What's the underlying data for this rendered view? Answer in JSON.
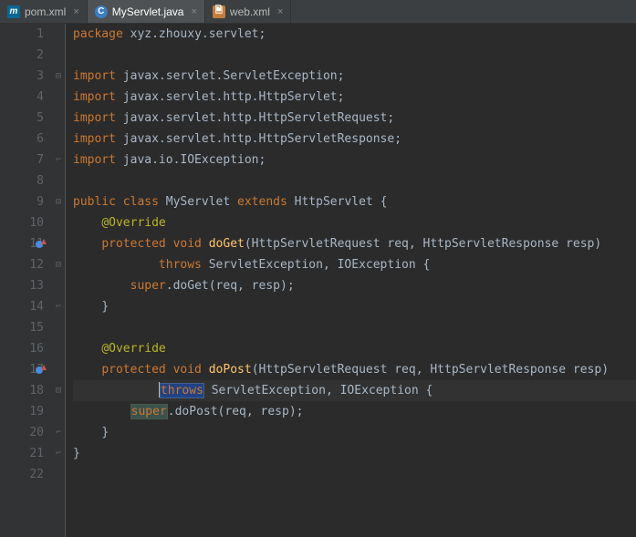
{
  "tabs": [
    {
      "icon": "m",
      "label": "pom.xml",
      "active": false
    },
    {
      "icon": "c",
      "label": "MyServlet.java",
      "active": true
    },
    {
      "icon": "x",
      "label": "web.xml",
      "active": false
    }
  ],
  "lines": {
    "l1_package": "package",
    "l1_pkg": " xyz.zhouxy.servlet",
    "l3_import": "import",
    "l3_val": " javax.servlet.ServletException",
    "l4_import": "import",
    "l4_val": " javax.servlet.http.HttpServlet",
    "l5_import": "import",
    "l5_val": " javax.servlet.http.HttpServletRequest",
    "l6_import": "import",
    "l6_val": " javax.servlet.http.HttpServletResponse",
    "l7_import": "import",
    "l7_val": " java.io.IOException",
    "l9_public": "public class ",
    "l9_name": "MyServlet",
    "l9_extends": " extends ",
    "l9_parent": "HttpServlet",
    "l9_brace": " {",
    "l10_ann": "@Override",
    "l11_mod": "protected void ",
    "l11_method": "doGet",
    "l11_params": "(HttpServletRequest req, HttpServletResponse resp)",
    "l12_throws": "throws",
    "l12_ex": " ServletException, IOException {",
    "l13_super": "super",
    "l13_call": ".doGet(req, resp)",
    "l14_brace": "}",
    "l16_ann": "@Override",
    "l17_mod": "protected void ",
    "l17_method": "doPost",
    "l17_params": "(HttpServletRequest req, HttpServletResponse resp)",
    "l18_throws": "throws",
    "l18_ex": " ServletException, IOException {",
    "l19_super": "super",
    "l19_call": ".doPost(req, resp)",
    "l20_brace": "}",
    "l21_brace": "}",
    "semicolon": ";"
  },
  "lineNumbers": [
    "1",
    "2",
    "3",
    "4",
    "5",
    "6",
    "7",
    "8",
    "9",
    "10",
    "11",
    "12",
    "13",
    "14",
    "15",
    "16",
    "17",
    "18",
    "19",
    "20",
    "21",
    "22"
  ]
}
